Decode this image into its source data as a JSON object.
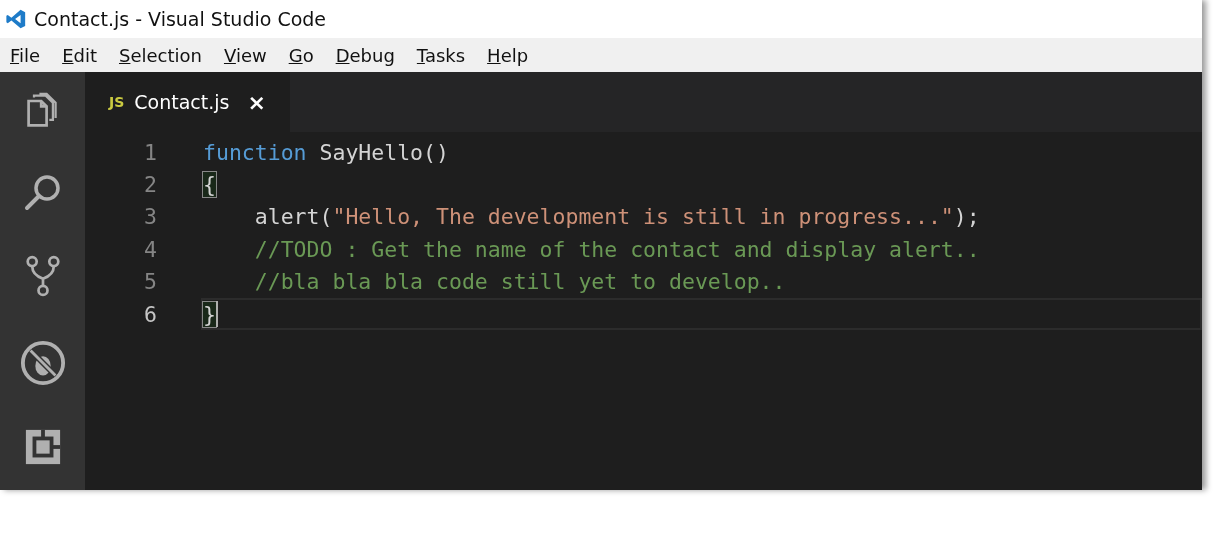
{
  "window": {
    "title": "Contact.js - Visual Studio Code"
  },
  "menu": [
    "File",
    "Edit",
    "Selection",
    "View",
    "Go",
    "Debug",
    "Tasks",
    "Help"
  ],
  "activity_bar": [
    {
      "kind": "explorer"
    },
    {
      "kind": "search"
    },
    {
      "kind": "source-control"
    },
    {
      "kind": "debug"
    },
    {
      "kind": "extensions"
    }
  ],
  "tabs": [
    {
      "label": "Contact.js",
      "badge": "JS",
      "close": "×",
      "selected": true
    }
  ],
  "editor": {
    "lines": [
      {
        "number": "1",
        "current": false,
        "tokens": [
          {
            "kind": "keyword",
            "text": "function"
          },
          {
            "kind": "plain",
            "text": " SayHello()"
          }
        ]
      },
      {
        "number": "2",
        "current": false,
        "tokens": [
          {
            "kind": "bracket",
            "text": "{"
          }
        ]
      },
      {
        "number": "3",
        "current": false,
        "tokens": [
          {
            "kind": "plain",
            "text": "    alert("
          },
          {
            "kind": "string",
            "text": "\"Hello, The development is still in progress...\""
          },
          {
            "kind": "plain",
            "text": ");"
          }
        ]
      },
      {
        "number": "4",
        "current": false,
        "tokens": [
          {
            "kind": "comment",
            "text": "    //TODO : Get the name of the contact and display alert.."
          }
        ]
      },
      {
        "number": "5",
        "current": false,
        "tokens": [
          {
            "kind": "comment",
            "text": "    //bla bla bla code still yet to develop.."
          }
        ]
      },
      {
        "number": "6",
        "current": true,
        "tokens": [
          {
            "kind": "bracket",
            "text": "}"
          }
        ]
      }
    ]
  }
}
